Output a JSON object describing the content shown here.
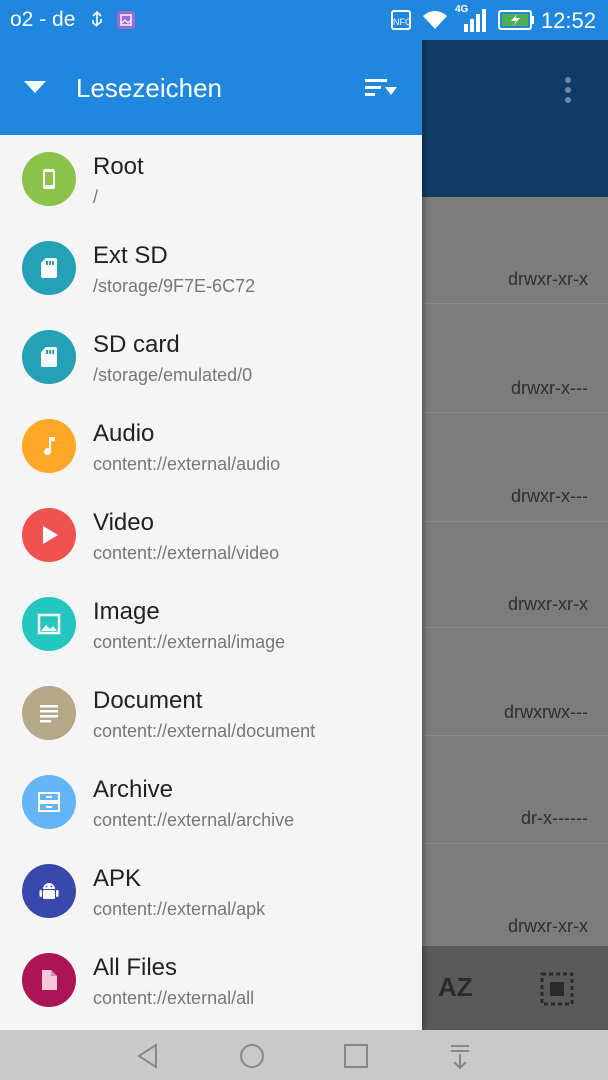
{
  "status_bar": {
    "carrier": "o2 - de",
    "nfc": "NFC",
    "network": "4G",
    "time": "12:52"
  },
  "drawer": {
    "title": "Lesezeichen",
    "bookmarks": [
      {
        "label": "Root",
        "path": "/",
        "color": "#8bc34a",
        "icon": "phone-icon"
      },
      {
        "label": "Ext SD",
        "path": "/storage/9F7E-6C72",
        "color": "#26a0b6",
        "icon": "sd-card-icon"
      },
      {
        "label": "SD card",
        "path": "/storage/emulated/0",
        "color": "#26a0b6",
        "icon": "sd-card-icon"
      },
      {
        "label": "Audio",
        "path": "content://external/audio",
        "color": "#ffa726",
        "icon": "music-note-icon"
      },
      {
        "label": "Video",
        "path": "content://external/video",
        "color": "#ef5350",
        "icon": "play-icon"
      },
      {
        "label": "Image",
        "path": "content://external/image",
        "color": "#26c6c0",
        "icon": "image-icon"
      },
      {
        "label": "Document",
        "path": "content://external/document",
        "color": "#b5a889",
        "icon": "document-icon"
      },
      {
        "label": "Archive",
        "path": "content://external/archive",
        "color": "#64b5f6",
        "icon": "archive-icon"
      },
      {
        "label": "APK",
        "path": "content://external/apk",
        "color": "#3949ab",
        "icon": "android-icon"
      },
      {
        "label": "All Files",
        "path": "content://external/all",
        "color": "#ad1457",
        "icon": "file-icon"
      }
    ]
  },
  "background": {
    "permissions": [
      "drwxr-xr-x",
      "drwxr-x---",
      "drwxr-x---",
      "drwxr-xr-x",
      "drwxrwx---",
      "dr-x------",
      "drwxr-xr-x"
    ],
    "sort_label": "AZ"
  }
}
